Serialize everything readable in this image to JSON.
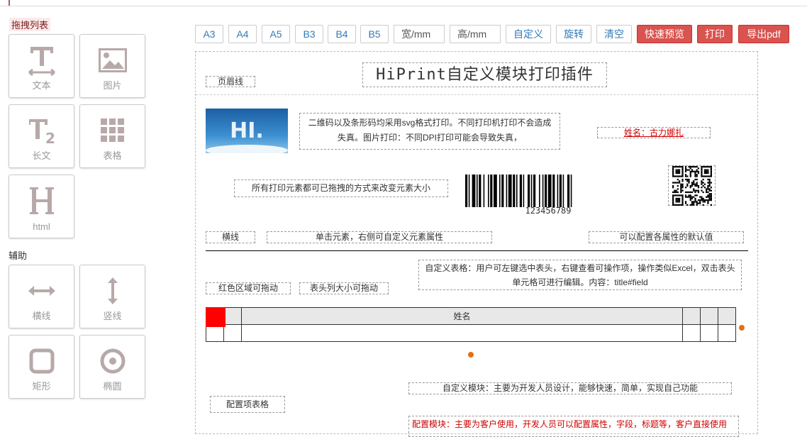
{
  "sidebar": {
    "drag_title": "拖拽列表",
    "assist_title": "辅助",
    "drag_items": [
      {
        "label": "文本",
        "icon": "text-icon"
      },
      {
        "label": "图片",
        "icon": "image-icon"
      },
      {
        "label": "长文",
        "icon": "long-text-icon"
      },
      {
        "label": "表格",
        "icon": "table-icon"
      },
      {
        "label": "html",
        "icon": "html-icon"
      }
    ],
    "assist_items": [
      {
        "label": "横线",
        "icon": "horizontal-line-icon"
      },
      {
        "label": "竖线",
        "icon": "vertical-line-icon"
      },
      {
        "label": "矩形",
        "icon": "rectangle-icon"
      },
      {
        "label": "椭圆",
        "icon": "ellipse-icon"
      }
    ]
  },
  "toolbar": {
    "sizes": [
      "A3",
      "A4",
      "A5",
      "B3",
      "B4",
      "B5"
    ],
    "width_placeholder": "宽/mm",
    "height_placeholder": "高/mm",
    "custom": "自定义",
    "rotate": "旋转",
    "clear": "清空",
    "preview": "快速预览",
    "print": "打印",
    "export_pdf": "导出pdf"
  },
  "template": {
    "header_line": "页眉线",
    "title": "HiPrint自定义模块打印插件",
    "logo_text": "HI.",
    "svg_note": "二维码以及条形码均采用svg格式打印。不同打印机打印不会造成失真。图片打印：不同DPI打印可能会导致失真，",
    "name_field": "姓名：古力娜扎",
    "resize_note": "所有打印元素都可已拖拽的方式来改变元素大小",
    "barcode_value": "123456789",
    "hline_label": "横线",
    "click_note": "单击元素，右侧可自定义元素属性",
    "default_note": "可以配置各属性的默认值",
    "red_drag": "红色区域可拖动",
    "col_resize": "表头列大小可拖动",
    "table_note": "自定义表格：用户可左键选中表头，右键查看可操作项，操作类似Excel，双击表头单元格可进行编辑。内容：title#field",
    "table_header": [
      "",
      "",
      "姓名",
      "",
      "",
      ""
    ],
    "custom_module": "自定义模块：主要为开发人员设计，能够快速，简单，实现自己功能",
    "config_table": "配置项表格",
    "config_module": "配置模块：主要为客户使用，开发人员可以配置属性，字段，标题等，客户直接使用"
  },
  "colors": {
    "accent": "#337ab7",
    "danger": "#d9534f",
    "drag_handle": "#ff0000",
    "resize_dot": "#e6700f"
  }
}
